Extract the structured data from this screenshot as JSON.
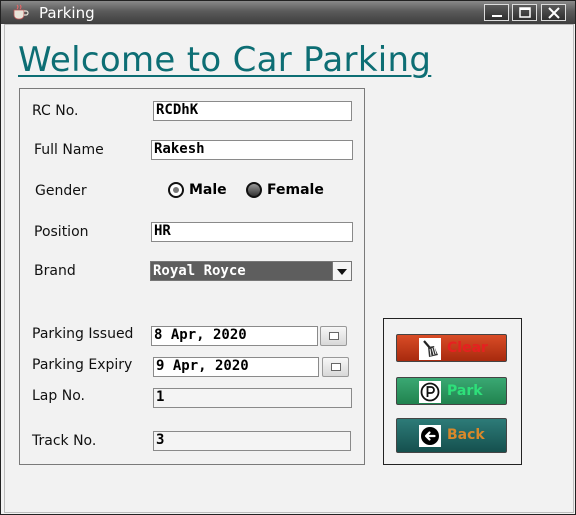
{
  "window": {
    "title": "Parking"
  },
  "heading": "Welcome to Car Parking",
  "form": {
    "rc_label": "RC No.",
    "rc_value": "RCDhK",
    "name_label": "Full Name",
    "name_value": "Rakesh",
    "gender_label": "Gender",
    "gender_options": [
      "Male",
      "Female"
    ],
    "gender_selected": "Male",
    "position_label": "Position",
    "position_value": "HR",
    "brand_label": "Brand",
    "brand_value": "Royal Royce",
    "issued_label": "Parking Issued",
    "issued_value": "8 Apr, 2020",
    "expiry_label": "Parking Expiry",
    "expiry_value": "9 Apr, 2020",
    "lap_label": "Lap No.",
    "lap_value": "1",
    "track_label": "Track No.",
    "track_value": "3"
  },
  "actions": {
    "clear_label": "Clear",
    "park_label": "Park",
    "back_label": "Back"
  },
  "colors": {
    "heading": "#0d6e74",
    "clear_button": "#c03a18",
    "park_button": "#2e9a62",
    "back_button": "#1f6664"
  }
}
